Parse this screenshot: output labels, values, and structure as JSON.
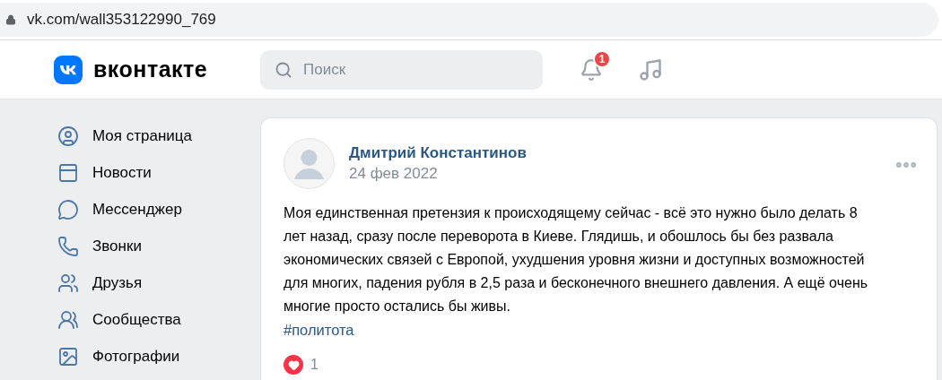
{
  "address_bar": {
    "url": "vk.com/wall353122990_769"
  },
  "header": {
    "logo": "вконтакте",
    "search": {
      "placeholder": "Поиск"
    },
    "notifications": {
      "badge": "1"
    }
  },
  "sidebar": {
    "items": [
      {
        "label": "Моя страница"
      },
      {
        "label": "Новости"
      },
      {
        "label": "Мессенджер"
      },
      {
        "label": "Звонки"
      },
      {
        "label": "Друзья"
      },
      {
        "label": "Сообщества"
      },
      {
        "label": "Фотографии"
      }
    ]
  },
  "post": {
    "author": "Дмитрий Константинов",
    "date": "24 фев 2022",
    "text": "Моя единственная претензия к происходящему сейчас - всё это нужно было делать 8 лет назад, сразу после переворота в Киеве. Глядишь, и обошлось бы без развала экономических связей с Европой, ухудшения уровня жизни и доступных возможностей для многих, падения рубля в 2,5 раза и бесконечного внешнего давления. А ещё очень многие просто остались бы живы.",
    "hashtag": "#политота",
    "likes": {
      "count": "1",
      "liked": true
    }
  }
}
